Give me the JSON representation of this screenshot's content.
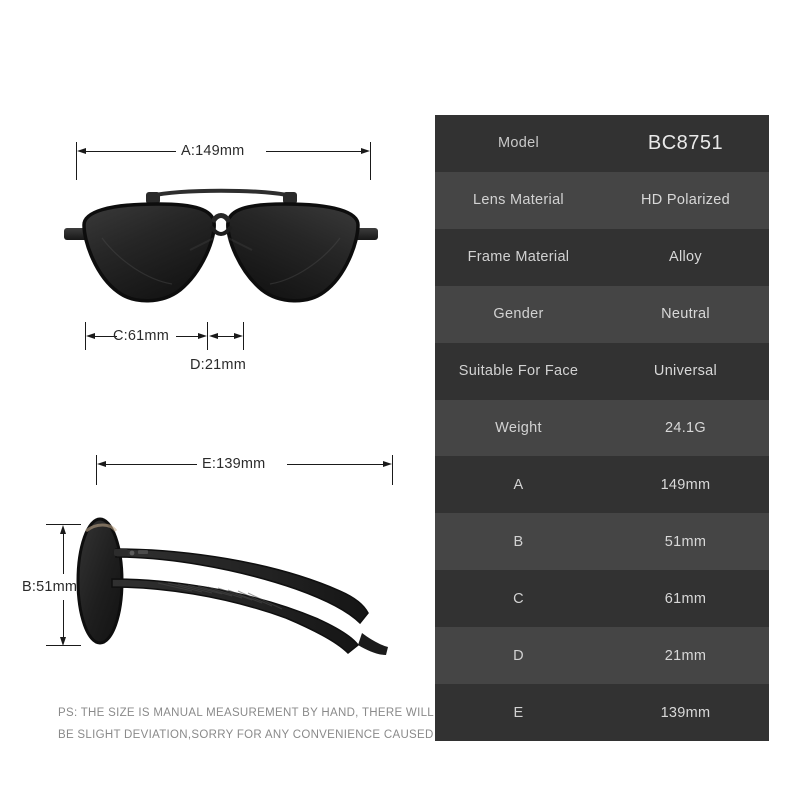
{
  "dimensions": {
    "a": {
      "label": "A:149mm"
    },
    "b": {
      "label": "B:51mm"
    },
    "c": {
      "label": "C:61mm"
    },
    "d": {
      "label": "D:21mm"
    },
    "e": {
      "label": "E:139mm"
    }
  },
  "disclaimer": {
    "line1": "PS: THE SIZE IS MANUAL MEASUREMENT BY HAND, THERE WILL",
    "line2": "BE SLIGHT DEVIATION,SORRY FOR ANY CONVENIENCE CAUSED"
  },
  "spec_table": {
    "rows": [
      {
        "key": "Model",
        "value": "BC8751"
      },
      {
        "key": "Lens Material",
        "value": "HD Polarized"
      },
      {
        "key": "Frame Material",
        "value": "Alloy"
      },
      {
        "key": "Gender",
        "value": "Neutral"
      },
      {
        "key": "Suitable For Face",
        "value": "Universal"
      },
      {
        "key": "Weight",
        "value": "24.1G"
      },
      {
        "key": "A",
        "value": "149mm"
      },
      {
        "key": "B",
        "value": "51mm"
      },
      {
        "key": "C",
        "value": "61mm"
      },
      {
        "key": "D",
        "value": "21mm"
      },
      {
        "key": "E",
        "value": "139mm"
      }
    ]
  },
  "colors": {
    "row_dark": "#323232",
    "row_light": "#454545",
    "text_primary": "#d8d8d8",
    "diagram_line": "#1a1a1a",
    "disclaimer_text": "#8a8a8a"
  }
}
